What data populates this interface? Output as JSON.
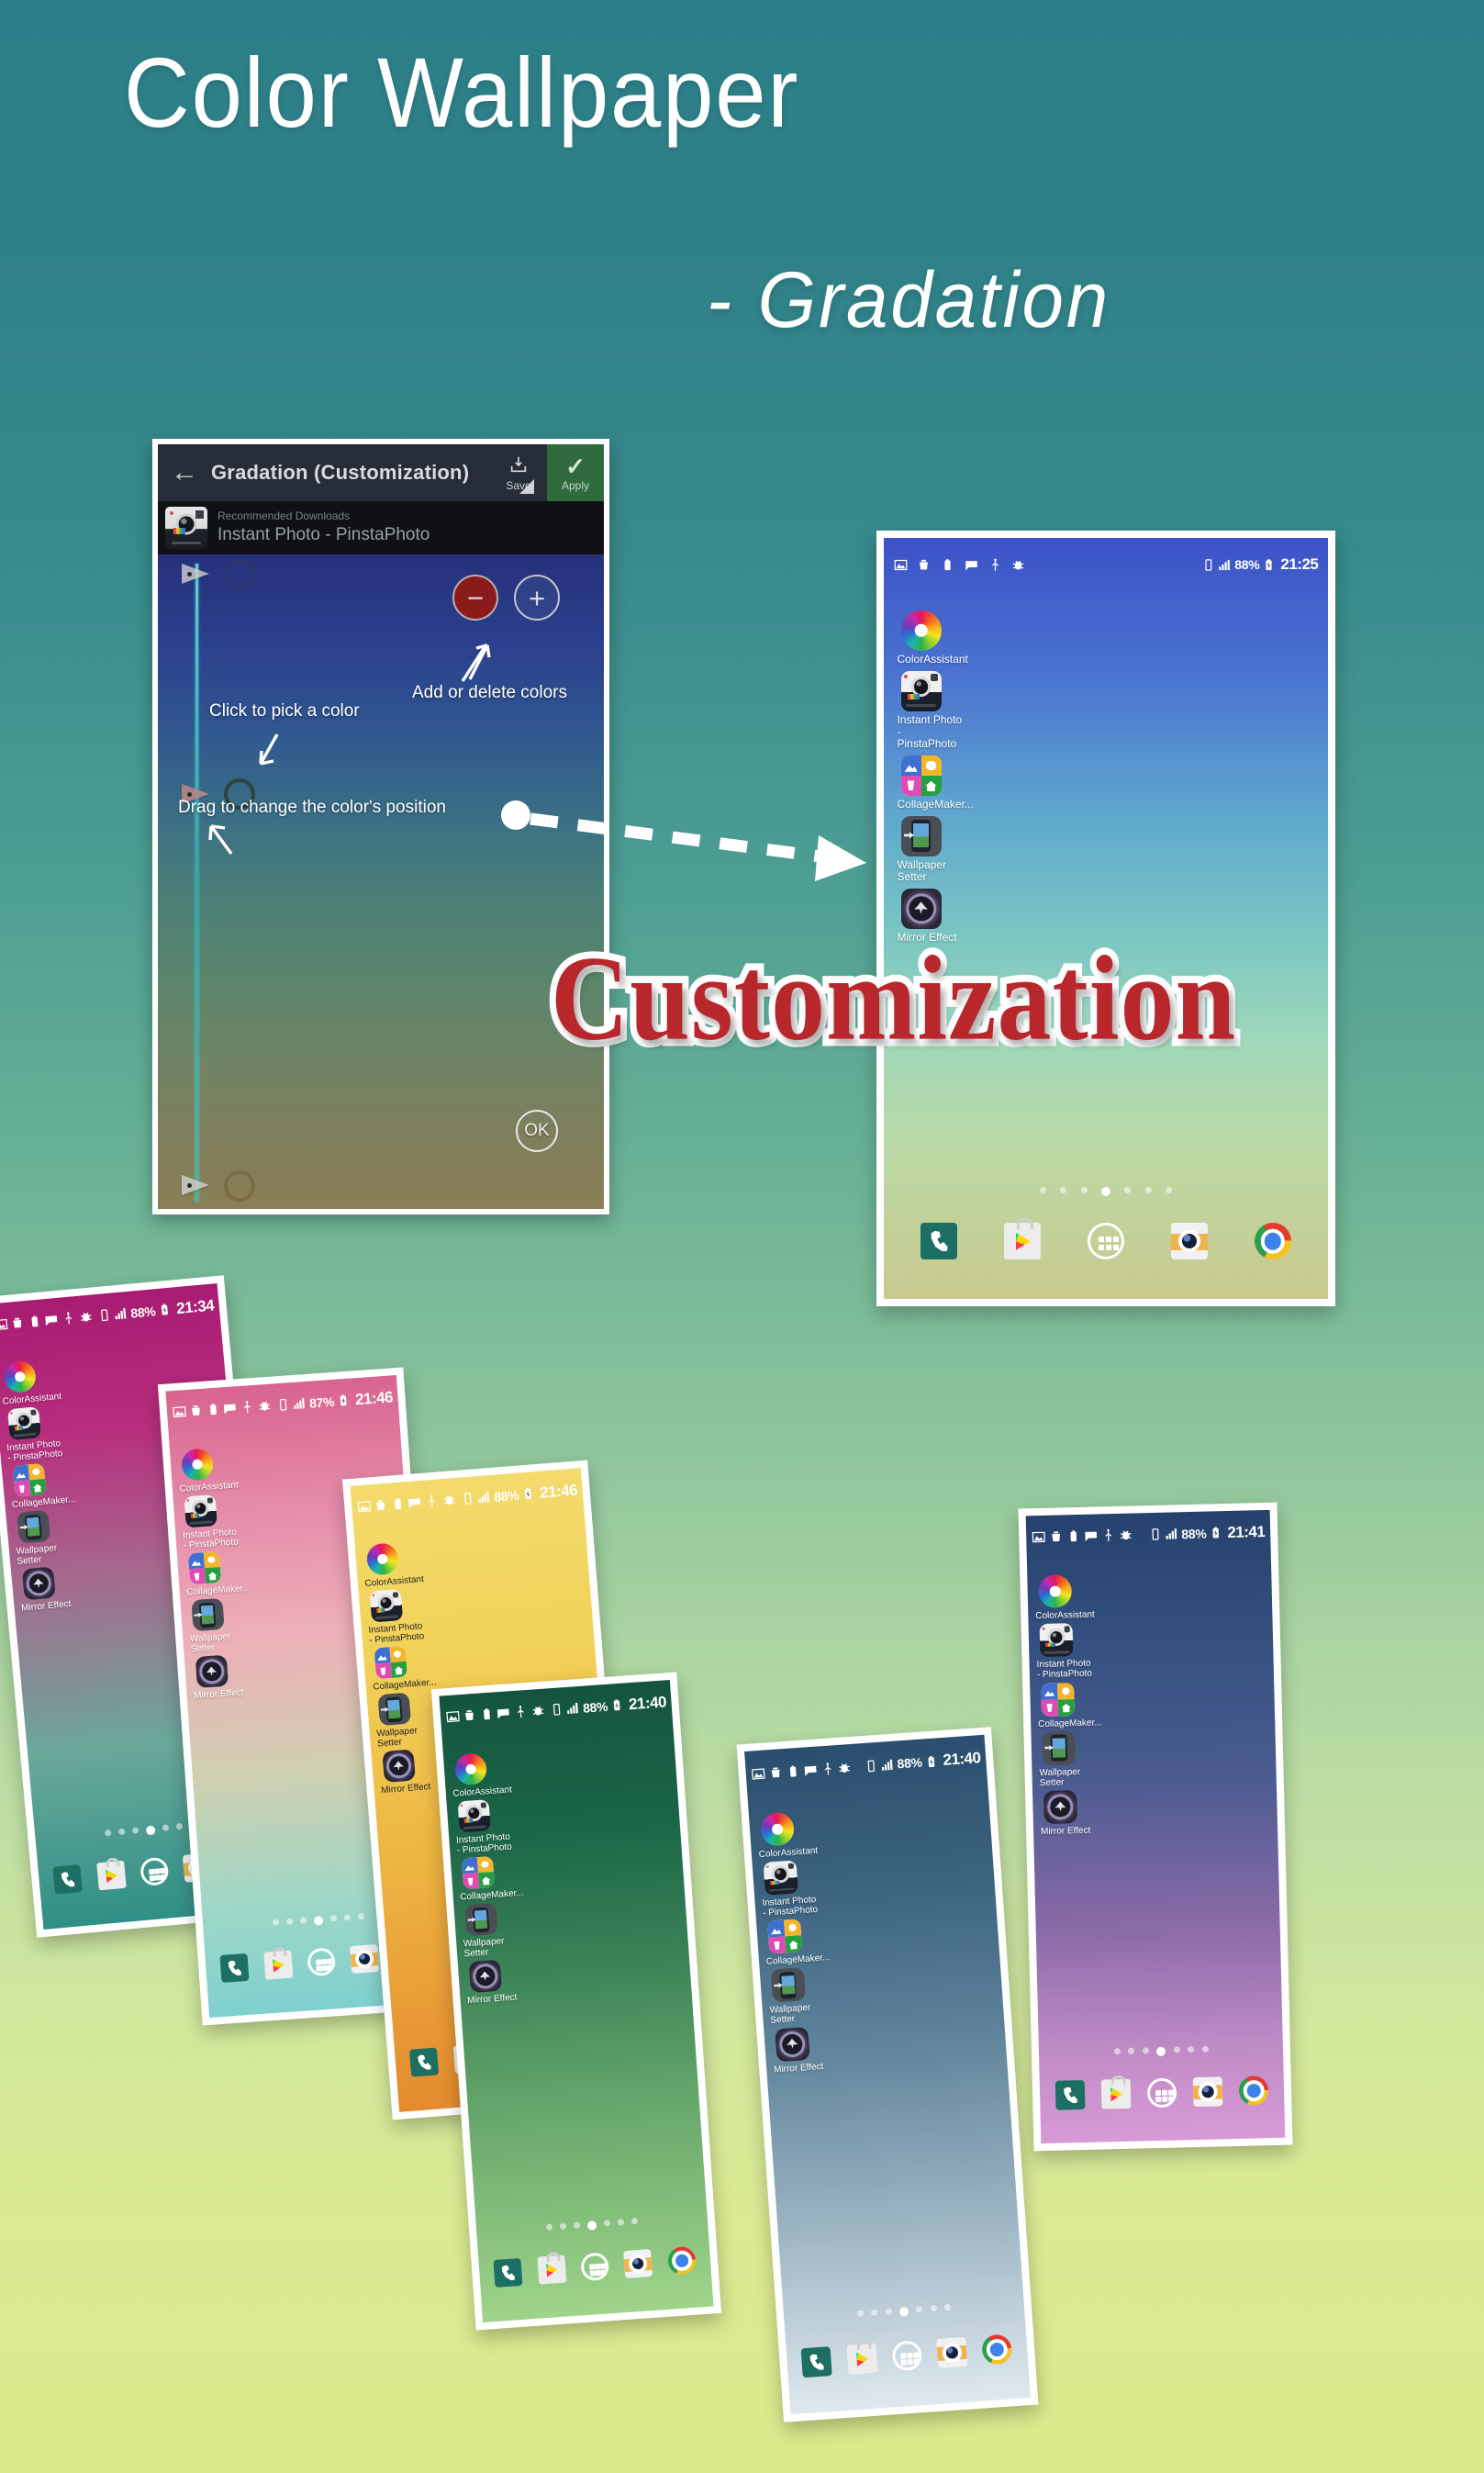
{
  "headings": {
    "title": "Color Wallpaper",
    "subtitle": "-  Gradation",
    "overlay_word": "Customization"
  },
  "colors": {
    "background_top": "#2c7f88",
    "background_bottom": "#dcea8c",
    "overlay_word_fill": "#b8272c",
    "overlay_word_outline": "#ffffff",
    "apply_button_bg": "#2f6b3c",
    "minus_button_bg": "#8b1b1b"
  },
  "editor": {
    "back_icon": "back-arrow-icon",
    "title": "Gradation (Customization)",
    "save_label": "Save",
    "save_icon": "save-download-icon",
    "apply_label": "Apply",
    "apply_icon": "check-icon",
    "promo": {
      "eyebrow": "Recommended Downloads",
      "name": "Instant Photo - PinstaPhoto",
      "icon": "instant-camera-icon"
    },
    "minus_label": "−",
    "plus_label": "+",
    "hints": {
      "add_delete": "Add or delete colors",
      "pick": "Click to pick a color",
      "drag": "Drag to change the color's position"
    },
    "ok_label": "OK",
    "gradient_stops": [
      "#26307a",
      "#3a6f85",
      "#8a7e55"
    ]
  },
  "status_icons": [
    "image-icon",
    "trash-icon",
    "battery-icon",
    "message-icon",
    "usb-icon",
    "bug-icon"
  ],
  "status_right_icons": [
    "vibrate-icon",
    "signal-bars-icon",
    "battery-charging-icon"
  ],
  "apps": [
    {
      "name": "ColorAssistant",
      "icon": "color-wheel-icon"
    },
    {
      "name": "Instant Photo - PinstaPhoto",
      "icon": "instant-camera-icon"
    },
    {
      "name": "CollageMaker...",
      "icon": "collage-maker-icon"
    },
    {
      "name": "Wallpaper Setter",
      "icon": "wallpaper-setter-icon"
    },
    {
      "name": "Mirror Effect",
      "icon": "mirror-effect-icon"
    }
  ],
  "dock": [
    {
      "name": "Phone",
      "icon": "phone-icon"
    },
    {
      "name": "Play Store",
      "icon": "play-store-icon"
    },
    {
      "name": "App Drawer",
      "icon": "app-drawer-icon"
    },
    {
      "name": "Camera",
      "icon": "camera-icon"
    },
    {
      "name": "Chrome",
      "icon": "chrome-icon"
    }
  ],
  "page_dots": {
    "count": 7,
    "active_index": 3
  },
  "phones": [
    {
      "id": "main",
      "battery": "88%",
      "clock": "21:25",
      "wallpaper_from": "#3c52c8",
      "wallpaper_to": "#c9c98f",
      "label_dark": false
    },
    {
      "id": "magenta",
      "battery": "88%",
      "clock": "21:34",
      "wallpaper_from": "#a81b72",
      "wallpaper_to": "#2f8f86",
      "label_dark": false
    },
    {
      "id": "pink",
      "battery": "87%",
      "clock": "21:46",
      "wallpaper_from": "#d8648f",
      "wallpaper_to": "#7fd0cf",
      "label_dark": false
    },
    {
      "id": "yellow",
      "battery": "88%",
      "clock": "21:46",
      "wallpaper_from": "#f2d35a",
      "wallpaper_to": "#e38a2e",
      "label_dark": true
    },
    {
      "id": "green",
      "battery": "88%",
      "clock": "21:40",
      "wallpaper_from": "#14543f",
      "wallpaper_to": "#9fd48a",
      "label_dark": false
    },
    {
      "id": "steel",
      "battery": "88%",
      "clock": "21:40",
      "wallpaper_from": "#2a4f6e",
      "wallpaper_to": "#dfe8ee",
      "label_dark": false
    },
    {
      "id": "blue-purple",
      "battery": "88%",
      "clock": "21:41",
      "wallpaper_from": "#27416e",
      "wallpaper_to": "#d89ad6",
      "label_dark": false
    }
  ]
}
